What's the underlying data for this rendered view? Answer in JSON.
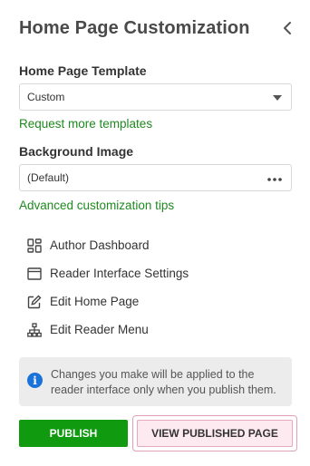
{
  "header": {
    "title": "Home Page Customization",
    "collapse_icon": "chevron-left-icon"
  },
  "template": {
    "label": "Home Page Template",
    "value": "Custom",
    "link": "Request more templates"
  },
  "background": {
    "label": "Background Image",
    "value": "(Default)",
    "link": "Advanced customization tips"
  },
  "menu": {
    "items": [
      {
        "label": "Author Dashboard",
        "icon": "dashboard-icon"
      },
      {
        "label": "Reader Interface Settings",
        "icon": "window-icon"
      },
      {
        "label": "Edit Home Page",
        "icon": "edit-icon"
      },
      {
        "label": "Edit Reader Menu",
        "icon": "sitemap-icon"
      }
    ]
  },
  "info": {
    "text": "Changes you make will be applied to the reader interface only when you publish them."
  },
  "actions": {
    "publish": "PUBLISH",
    "view_published": "VIEW PUBLISHED PAGE"
  },
  "colors": {
    "accent_green": "#0f9a0f",
    "link_green": "#1f8a1f",
    "info_blue": "#1a73d9",
    "highlight_pink": "#fde9f0"
  }
}
